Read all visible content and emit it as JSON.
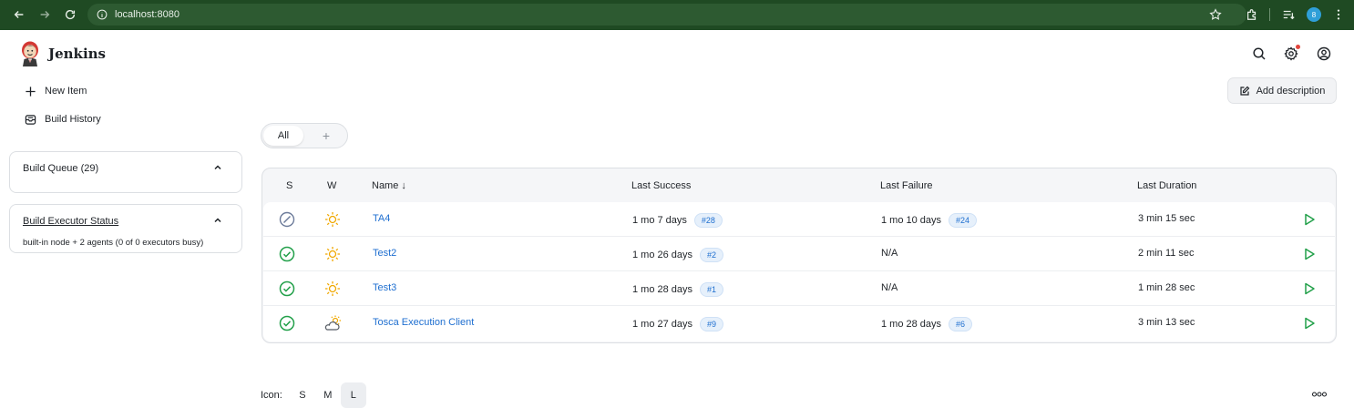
{
  "browser": {
    "url": "localhost:8080",
    "profile_initial": "8",
    "accent_color": "#1f4a23"
  },
  "header": {
    "brand": "Jenkins",
    "icons": [
      "search-icon",
      "gear-icon",
      "user-icon"
    ]
  },
  "sidebar": {
    "tasks": [
      {
        "label": "New Item",
        "icon": "plus-icon"
      },
      {
        "label": "Build History",
        "icon": "inbox-icon"
      }
    ],
    "build_queue": {
      "title": "Build Queue (29)"
    },
    "executor_status": {
      "title": "Build Executor Status",
      "subtitle": "built-in node + 2 agents (0 of 0 executors busy)"
    }
  },
  "main": {
    "add_description": "Add description",
    "tabs": [
      {
        "label": "All"
      },
      {
        "label": "+"
      }
    ],
    "table": {
      "headers": {
        "s": "S",
        "w": "W",
        "name": "Name ↓",
        "last_success": "Last Success",
        "last_failure": "Last Failure",
        "last_duration": "Last Duration"
      },
      "rows": [
        {
          "status": "disabled",
          "weather": "sunny",
          "name": "TA4",
          "last_success": "1 mo 7 days",
          "success_build": "#28",
          "last_failure": "1 mo 10 days",
          "failure_build": "#24",
          "duration": "3 min 15 sec"
        },
        {
          "status": "success",
          "weather": "sunny",
          "name": "Test2",
          "last_success": "1 mo 26 days",
          "success_build": "#2",
          "last_failure": "N/A",
          "failure_build": "",
          "duration": "2 min 11 sec"
        },
        {
          "status": "success",
          "weather": "sunny",
          "name": "Test3",
          "last_success": "1 mo 28 days",
          "success_build": "#1",
          "last_failure": "N/A",
          "failure_build": "",
          "duration": "1 min 28 sec"
        },
        {
          "status": "success",
          "weather": "partly-cloudy",
          "name": "Tosca Execution Client",
          "last_success": "1 mo 27 days",
          "success_build": "#9",
          "last_failure": "1 mo 28 days",
          "failure_build": "#6",
          "duration": "3 min 13 sec"
        }
      ]
    },
    "icon_size": {
      "label": "Icon:",
      "options": [
        "S",
        "M",
        "L"
      ],
      "selected": "L"
    }
  },
  "colors": {
    "success": "#22a04a",
    "link": "#1f6fd0",
    "sun": "#f0a800"
  }
}
